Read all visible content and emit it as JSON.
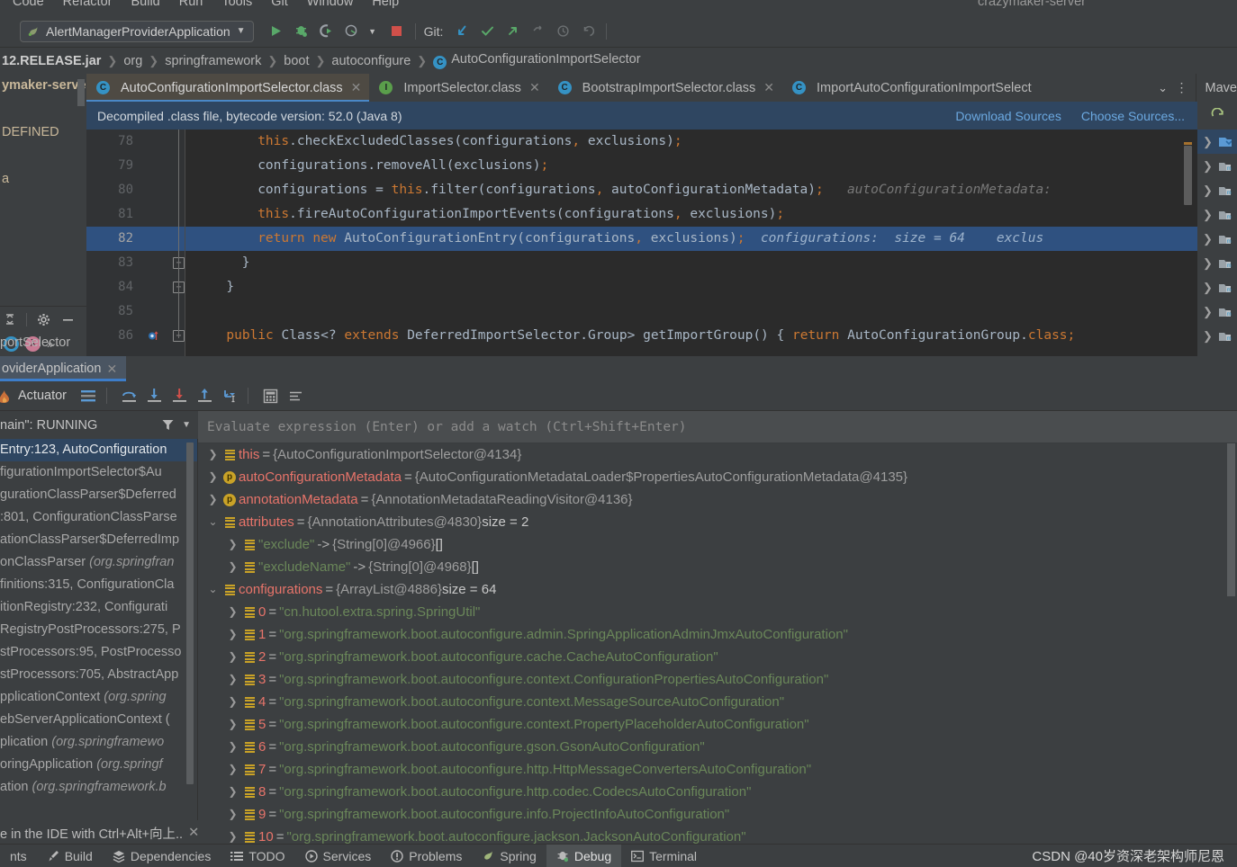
{
  "menu": {
    "items": [
      "Code",
      "Refactor",
      "Build",
      "Run",
      "Tools",
      "Git",
      "Window",
      "Help"
    ],
    "project_label": "crazymaker-server"
  },
  "toolbar": {
    "run_configuration": "AlertManagerProviderApplication",
    "git_label": "Git:",
    "icons": [
      "run-icon",
      "debug-icon",
      "run-with-coverage-icon",
      "profile-icon",
      "dropdown-icon",
      "stop-icon"
    ],
    "git_icons": [
      "update-project-icon",
      "commit-icon",
      "push-icon",
      "branch-icon",
      "history-icon",
      "rollback-icon"
    ]
  },
  "breadcrumb": {
    "items": [
      {
        "label": "12.RELEASE.jar",
        "icon": "jar-icon"
      },
      {
        "label": "org",
        "icon": "package-icon"
      },
      {
        "label": "springframework",
        "icon": "package-icon"
      },
      {
        "label": "boot",
        "icon": "package-icon"
      },
      {
        "label": "autoconfigure",
        "icon": "package-icon"
      },
      {
        "label": "AutoConfigurationImportSelector",
        "icon": "class-icon"
      }
    ]
  },
  "editor_tabs": {
    "tabs": [
      {
        "label": "AutoConfigurationImportSelector.class",
        "icon": "class-icon",
        "kind": "c",
        "active": true
      },
      {
        "label": "ImportSelector.class",
        "icon": "interface-icon",
        "kind": "i",
        "active": false
      },
      {
        "label": "BootstrapImportSelector.class",
        "icon": "class-icon",
        "kind": "c",
        "active": false
      },
      {
        "label": "ImportAutoConfigurationImportSelect",
        "icon": "class-icon",
        "kind": "c",
        "active": false
      }
    ],
    "overflow_icon": "chevron-down-icon",
    "more_icon": "more-vertical-icon",
    "maven_label": "Mave"
  },
  "banner": {
    "text": "Decompiled .class file, bytecode version: 52.0 (Java 8)",
    "download_sources": "Download Sources",
    "choose_sources": "Choose Sources...",
    "refresh_icon": "refresh-icon"
  },
  "editor": {
    "current_line": 82,
    "lines": [
      {
        "no": "78",
        "indent": 6,
        "segments": [
          {
            "t": "this",
            "c": "k"
          },
          {
            "t": ".checkExcludedClasses(configurations",
            "c": "plain"
          },
          {
            "t": ",",
            "c": "sep"
          },
          {
            "t": " exclusions)",
            "c": "plain"
          },
          {
            "t": ";",
            "c": "sep"
          }
        ]
      },
      {
        "no": "79",
        "indent": 6,
        "segments": [
          {
            "t": "configurations.removeAll(exclusions)",
            "c": "plain"
          },
          {
            "t": ";",
            "c": "sep"
          }
        ]
      },
      {
        "no": "80",
        "indent": 6,
        "segments": [
          {
            "t": "configurations = ",
            "c": "plain"
          },
          {
            "t": "this",
            "c": "k"
          },
          {
            "t": ".filter(configurations",
            "c": "plain"
          },
          {
            "t": ",",
            "c": "sep"
          },
          {
            "t": " autoConfigurationMetadata)",
            "c": "plain"
          },
          {
            "t": ";",
            "c": "sep"
          },
          {
            "t": "   autoConfigurationMetadata:",
            "c": "hint"
          }
        ]
      },
      {
        "no": "81",
        "indent": 6,
        "segments": [
          {
            "t": "this",
            "c": "k"
          },
          {
            "t": ".fireAutoConfigurationImportEvents(configurations",
            "c": "plain"
          },
          {
            "t": ",",
            "c": "sep"
          },
          {
            "t": " exclusions)",
            "c": "plain"
          },
          {
            "t": ";",
            "c": "sep"
          }
        ]
      },
      {
        "no": "82",
        "indent": 6,
        "highlight": true,
        "segments": [
          {
            "t": "return",
            "c": "k"
          },
          {
            "t": " ",
            "c": "plain"
          },
          {
            "t": "new",
            "c": "k"
          },
          {
            "t": " AutoConfigurationEntry(configurations",
            "c": "plain"
          },
          {
            "t": ",",
            "c": "sep"
          },
          {
            "t": " exclusions)",
            "c": "plain"
          },
          {
            "t": ";",
            "c": "sep"
          },
          {
            "t": "  configurations:  size = 64    exclus",
            "c": "hint-hl"
          }
        ]
      },
      {
        "no": "83",
        "indent": 4,
        "fold": true,
        "segments": [
          {
            "t": "}",
            "c": "plain"
          }
        ]
      },
      {
        "no": "84",
        "indent": 2,
        "fold": true,
        "segments": [
          {
            "t": "}",
            "c": "plain"
          }
        ]
      },
      {
        "no": "85",
        "indent": 0,
        "segments": [
          {
            "t": "",
            "c": "plain"
          }
        ]
      },
      {
        "no": "86",
        "indent": 2,
        "breakpoint": true,
        "foldplus": true,
        "segments": [
          {
            "t": "public",
            "c": "k"
          },
          {
            "t": " Class<? ",
            "c": "plain"
          },
          {
            "t": "extends",
            "c": "k"
          },
          {
            "t": " DeferredImportSelector.Group> ",
            "c": "plain"
          },
          {
            "t": "getImportGroup",
            "c": "plain"
          },
          {
            "t": "() { ",
            "c": "plain"
          },
          {
            "t": "return",
            "c": "k"
          },
          {
            "t": " AutoConfigurationGroup.",
            "c": "plain"
          },
          {
            "t": "class",
            "c": "k"
          },
          {
            "t": ";",
            "c": "sep"
          }
        ]
      }
    ]
  },
  "left_panel": {
    "project_lines": [
      "ymaker-serve",
      "",
      "DEFINED",
      "",
      "a"
    ],
    "structure_icons": [
      "collapse-all-icon",
      "settings-icon",
      "hide-icon"
    ],
    "structure_filters": [
      "field-filter-icon",
      "lambda-filter-icon",
      "more-icon"
    ],
    "structure_item": "portSelector"
  },
  "debug": {
    "session_tab": "oviderApplication",
    "actuator_label": "Actuator",
    "toolbar_icons": [
      "layout-icon",
      "step-over-icon",
      "step-into-icon",
      "force-step-into-icon",
      "step-out-icon",
      "run-to-cursor-icon",
      "evaluate-icon",
      "settings-icon"
    ],
    "thread_status": "nain\": RUNNING",
    "filter_icon": "filter-icon",
    "thread_dropdown_icon": "chevron-down-icon",
    "watch_placeholder": "Evaluate expression (Enter) or add a watch (Ctrl+Shift+Enter)",
    "frames": [
      {
        "text": "Entry:123, AutoConfiguration",
        "selected": true
      },
      {
        "text": "figurationImportSelector$Au",
        "selected": false
      },
      {
        "text": "gurationClassParser$Deferred",
        "selected": false
      },
      {
        "text": ":801, ConfigurationClassParse",
        "selected": false
      },
      {
        "text": "ationClassParser$DeferredImp",
        "selected": false
      },
      {
        "text": "onClassParser ",
        "italic": "(org.springfran",
        "selected": false
      },
      {
        "text": "finitions:315, ConfigurationCla",
        "selected": false
      },
      {
        "text": "itionRegistry:232, Configurati",
        "selected": false
      },
      {
        "text": "RegistryPostProcessors:275, P",
        "selected": false
      },
      {
        "text": "stProcessors:95, PostProcesso",
        "selected": false
      },
      {
        "text": "stProcessors:705, AbstractApp",
        "selected": false
      },
      {
        "text": "pplicationContext ",
        "italic": "(org.spring",
        "selected": false
      },
      {
        "text": "ebServerApplicationContext (",
        "selected": false
      },
      {
        "text": "plication ",
        "italic": "(org.springframewo",
        "selected": false
      },
      {
        "text": "oringApplication ",
        "italic": "(org.springf",
        "selected": false
      },
      {
        "text": "ation ",
        "italic": "(org.springframework.b",
        "selected": false
      }
    ],
    "hint_bar": "e in the IDE with Ctrl+Alt+向上..",
    "hint_close_icon": "close-icon",
    "variables": [
      {
        "indent": 0,
        "chev": "collapsed",
        "icon": "field-icon",
        "name": "this",
        "eq": "=",
        "value": "{AutoConfigurationImportSelector@4134}"
      },
      {
        "indent": 0,
        "chev": "collapsed",
        "icon": "parameter-icon",
        "name": "autoConfigurationMetadata",
        "eq": "=",
        "value": "{AutoConfigurationMetadataLoader$PropertiesAutoConfigurationMetadata@4135}"
      },
      {
        "indent": 0,
        "chev": "collapsed",
        "icon": "parameter-icon",
        "name": "annotationMetadata",
        "eq": "=",
        "value": "{AnnotationMetadataReadingVisitor@4136}"
      },
      {
        "indent": 0,
        "chev": "expanded",
        "icon": "field-icon",
        "name": "attributes",
        "eq": "=",
        "value": "{AnnotationAttributes@4830}",
        "size": "size = 2"
      },
      {
        "indent": 1,
        "chev": "collapsed",
        "icon": "field-icon",
        "name": "",
        "str": "\"exclude\"",
        "arrow": " -> ",
        "value": "{String[0]@4966}",
        "tail": "[]"
      },
      {
        "indent": 1,
        "chev": "collapsed",
        "icon": "field-icon",
        "name": "",
        "str": "\"excludeName\"",
        "arrow": " -> ",
        "value": "{String[0]@4968}",
        "tail": "[]"
      },
      {
        "indent": 0,
        "chev": "expanded",
        "icon": "field-icon",
        "name": "configurations",
        "eq": "=",
        "value": "{ArrayList@4886}",
        "size": "size = 64"
      },
      {
        "indent": 1,
        "chev": "collapsed",
        "icon": "field-icon",
        "name": "0",
        "eq": "=",
        "str": "\"cn.hutool.extra.spring.SpringUtil\""
      },
      {
        "indent": 1,
        "chev": "collapsed",
        "icon": "field-icon",
        "name": "1",
        "eq": "=",
        "str": "\"org.springframework.boot.autoconfigure.admin.SpringApplicationAdminJmxAutoConfiguration\""
      },
      {
        "indent": 1,
        "chev": "collapsed",
        "icon": "field-icon",
        "name": "2",
        "eq": "=",
        "str": "\"org.springframework.boot.autoconfigure.cache.CacheAutoConfiguration\""
      },
      {
        "indent": 1,
        "chev": "collapsed",
        "icon": "field-icon",
        "name": "3",
        "eq": "=",
        "str": "\"org.springframework.boot.autoconfigure.context.ConfigurationPropertiesAutoConfiguration\""
      },
      {
        "indent": 1,
        "chev": "collapsed",
        "icon": "field-icon",
        "name": "4",
        "eq": "=",
        "str": "\"org.springframework.boot.autoconfigure.context.MessageSourceAutoConfiguration\""
      },
      {
        "indent": 1,
        "chev": "collapsed",
        "icon": "field-icon",
        "name": "5",
        "eq": "=",
        "str": "\"org.springframework.boot.autoconfigure.context.PropertyPlaceholderAutoConfiguration\""
      },
      {
        "indent": 1,
        "chev": "collapsed",
        "icon": "field-icon",
        "name": "6",
        "eq": "=",
        "str": "\"org.springframework.boot.autoconfigure.gson.GsonAutoConfiguration\""
      },
      {
        "indent": 1,
        "chev": "collapsed",
        "icon": "field-icon",
        "name": "7",
        "eq": "=",
        "str": "\"org.springframework.boot.autoconfigure.http.HttpMessageConvertersAutoConfiguration\""
      },
      {
        "indent": 1,
        "chev": "collapsed",
        "icon": "field-icon",
        "name": "8",
        "eq": "=",
        "str": "\"org.springframework.boot.autoconfigure.http.codec.CodecsAutoConfiguration\""
      },
      {
        "indent": 1,
        "chev": "collapsed",
        "icon": "field-icon",
        "name": "9",
        "eq": "=",
        "str": "\"org.springframework.boot.autoconfigure.info.ProjectInfoAutoConfiguration\""
      },
      {
        "indent": 1,
        "chev": "collapsed",
        "icon": "field-icon",
        "name": "10",
        "eq": "=",
        "str": "\"org.springframework.boot.autoconfigure.jackson.JacksonAutoConfiguration\""
      }
    ]
  },
  "statusbar": {
    "items": [
      {
        "label": "nts",
        "icon": "",
        "active": false
      },
      {
        "label": "Build",
        "icon": "build-icon",
        "active": false
      },
      {
        "label": "Dependencies",
        "icon": "dependencies-icon",
        "active": false
      },
      {
        "label": "TODO",
        "icon": "todo-icon",
        "active": false
      },
      {
        "label": "Services",
        "icon": "services-icon",
        "active": false
      },
      {
        "label": "Problems",
        "icon": "problems-icon",
        "active": false
      },
      {
        "label": "Spring",
        "icon": "spring-icon",
        "active": false
      },
      {
        "label": "Debug",
        "icon": "debug-icon",
        "active": true
      },
      {
        "label": "Terminal",
        "icon": "terminal-icon",
        "active": false
      }
    ],
    "watermark": "CSDN @40岁资深老架构师尼恩"
  },
  "colors": {
    "background": "#3c3f41",
    "editor_bg": "#2b2b2b",
    "accent_blue": "#3d7dc9",
    "highlight_line": "#2f5180",
    "banner_bg": "#2f4661",
    "string_green": "#6a8759",
    "keyword_orange": "#cc7832",
    "var_red": "#e8746a",
    "field_gold": "#c9a227"
  }
}
